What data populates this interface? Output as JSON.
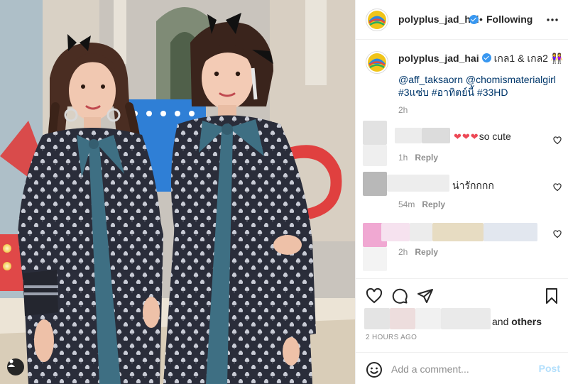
{
  "colors": {
    "link": "#00376b",
    "verified": "#3897f0",
    "muted": "#8e8e8e",
    "heart": "#ed4956",
    "post_disabled": "#b2dffc",
    "dress": "#2a2d3a",
    "bow": "#3e6f83"
  },
  "header": {
    "username": "polyplus_jad_hai",
    "separator": "•",
    "follow_status": "Following",
    "more_icon": "more-horizontal-icon"
  },
  "caption": {
    "username": "polyplus_jad_hai",
    "text": "เกล1 & เกล2 👭",
    "tags_line1": "@aff_taksaorn @chomismaterialgirl",
    "tags_line2": "#3แซ่บ #อาทิตย์นี้ #33HD",
    "time": "2h"
  },
  "comments": [
    {
      "hearts": "❤❤❤",
      "text": "so cute",
      "time": "1h",
      "reply": "Reply"
    },
    {
      "text": "น่ารักกกก",
      "time": "54m",
      "reply": "Reply"
    },
    {
      "text": "",
      "time": "2h",
      "reply": "Reply"
    }
  ],
  "actions": {
    "like_icon": "heart-outline-icon",
    "comment_icon": "comment-bubble-icon",
    "share_icon": "paper-plane-icon",
    "save_icon": "bookmark-icon"
  },
  "likes": {
    "suffix": "and",
    "others": "others"
  },
  "posted": "2 HOURS AGO",
  "add_comment": {
    "placeholder": "Add a comment...",
    "post_label": "Post",
    "emoji_icon": "emoji-smile-icon"
  }
}
